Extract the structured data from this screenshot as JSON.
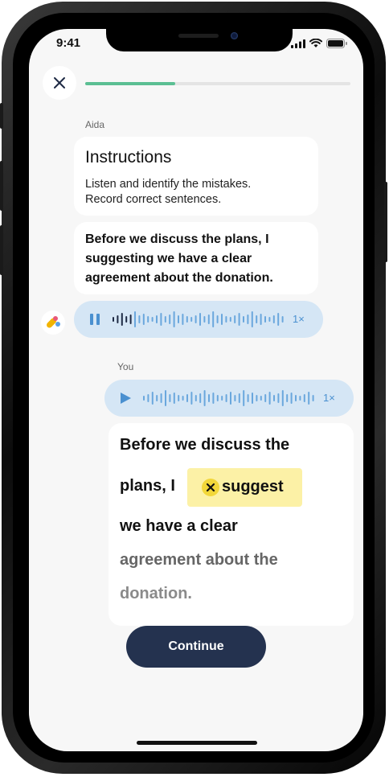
{
  "status_bar": {
    "time": "9:41"
  },
  "progress": {
    "fraction": 0.34
  },
  "chat": {
    "tutor_name": "Aida",
    "instructions": {
      "title": "Instructions",
      "text": "Listen and identify the mistakes. Record correct sentences."
    },
    "prompt_sentence": "Before we discuss the plans, I suggesting we have a clear agreement about the donation.",
    "tutor_audio": {
      "speed": "1×",
      "state": "playing"
    },
    "user_name": "You",
    "user_audio": {
      "speed": "1×",
      "state": "paused"
    },
    "answer": {
      "line1": "Before we discuss the",
      "line2_prefix": "plans, I",
      "corrected_word": "suggest",
      "line3": "we have a clear",
      "line4": "agreement about the",
      "line5": "donation."
    }
  },
  "continue_label": "Continue",
  "colors": {
    "progress": "#5bbf93",
    "audio_bubble": "#d5e6f5",
    "audio_accent": "#4a90d0",
    "highlight": "#fcf1a6",
    "button": "#24324f"
  },
  "icons": [
    "close-icon",
    "signal-icon",
    "wifi-icon",
    "battery-icon",
    "pause-icon",
    "play-icon",
    "waveform-icon",
    "avatar-logo-icon",
    "x-mark-icon"
  ]
}
